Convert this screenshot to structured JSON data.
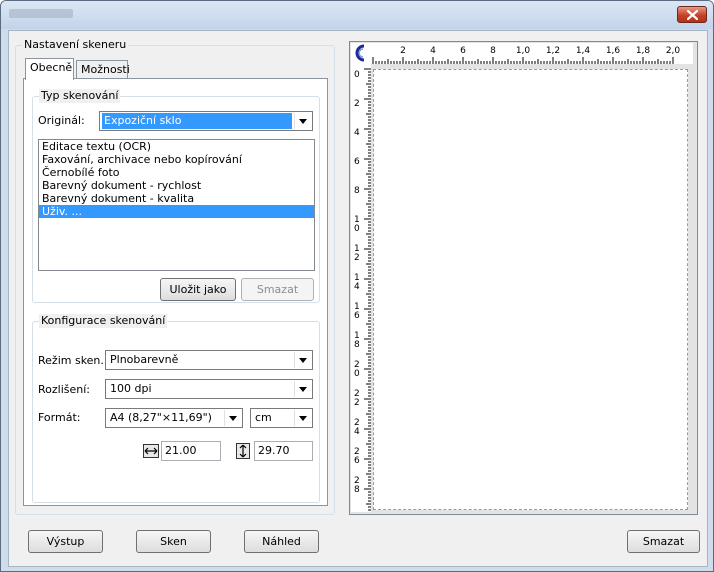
{
  "window": {
    "close_glyph": "close-icon"
  },
  "scanner_settings": {
    "legend": "Nastavení skeneru",
    "tabs": [
      {
        "label": "Obecně"
      },
      {
        "label": "Možnosti"
      }
    ],
    "scan_type": {
      "legend": "Typ skenování",
      "original_label": "Originál:",
      "original_value": "Expoziční sklo",
      "profiles": [
        {
          "label": "Editace textu (OCR)"
        },
        {
          "label": "Faxování, archivace nebo kopírování"
        },
        {
          "label": "Černobílé foto"
        },
        {
          "label": "Barevný dokument - rychlost"
        },
        {
          "label": "Barevný dokument - kvalita"
        },
        {
          "label": "Uživ. ..."
        }
      ],
      "selected_profile": "Uživ. ...",
      "save_as_label": "Uložit jako",
      "delete_label": "Smazat"
    },
    "scan_config": {
      "legend": "Konfigurace skenování",
      "mode_label": "Režim sken.:",
      "mode_value": "Plnobarevně",
      "resolution_label": "Rozlišení:",
      "resolution_value": "100 dpi",
      "format_label": "Formát:",
      "format_value": "A4 (8,27\"×11,69\")",
      "unit_value": "cm",
      "width_value": "21.00",
      "height_value": "29.70"
    }
  },
  "preview": {
    "ruler_h_labels": [
      "2",
      "4",
      "6",
      "8",
      "1,0",
      "1,2",
      "1,4",
      "1,6",
      "1,8",
      "2,0"
    ],
    "ruler_v_labels": [
      "0",
      "2",
      "4",
      "6",
      "8",
      "1 0",
      "1 2",
      "1 4",
      "1 6",
      "1 8",
      "2 0",
      "2 2",
      "2 4",
      "2 6",
      "2 8"
    ],
    "border_color": "#c8a000"
  },
  "footer": {
    "exit_label": "Výstup",
    "scan_label": "Sken",
    "preview_label": "Náhled",
    "clear_label": "Smazat"
  }
}
